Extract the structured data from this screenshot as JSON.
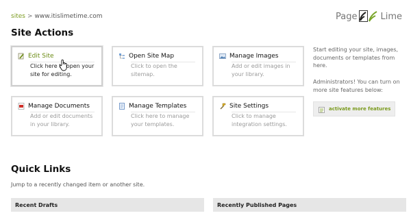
{
  "breadcrumb": {
    "root": "sites",
    "separator": ">",
    "site": "www.itislimetime.com"
  },
  "logo": {
    "left_text": "Page",
    "right_text": "Lime"
  },
  "site_actions": {
    "heading": "Site Actions",
    "cards": [
      {
        "title": "Edit Site",
        "desc": "Click here to open your site for editing.",
        "icon": "pencil-page-icon"
      },
      {
        "title": "Open Site Map",
        "desc": "Click to open the sitemap.",
        "icon": "sitemap-icon"
      },
      {
        "title": "Manage Images",
        "desc": "Add or edit images in your library.",
        "icon": "image-icon"
      },
      {
        "title": "Manage Documents",
        "desc": "Add or edit documents in your library.",
        "icon": "pdf-document-icon"
      },
      {
        "title": "Manage Templates",
        "desc": "Click here to manage your templates.",
        "icon": "template-icon"
      },
      {
        "title": "Site Settings",
        "desc": "Click to manage integration settings.",
        "icon": "settings-icon"
      }
    ]
  },
  "sidebar": {
    "intro": "Start editing your site, images, documents or templates from here.",
    "admin_note": "Administrators! You can turn on more site features below:",
    "feature_button": "activate more features"
  },
  "quick_links": {
    "heading": "Quick Links",
    "subtitle": "Jump to a recently changed item or another site.",
    "recent_drafts": "Recent Drafts",
    "recently_published": "Recently Published Pages"
  },
  "colors": {
    "accent": "#7a9a1d",
    "panel": "#e6e6e6"
  }
}
